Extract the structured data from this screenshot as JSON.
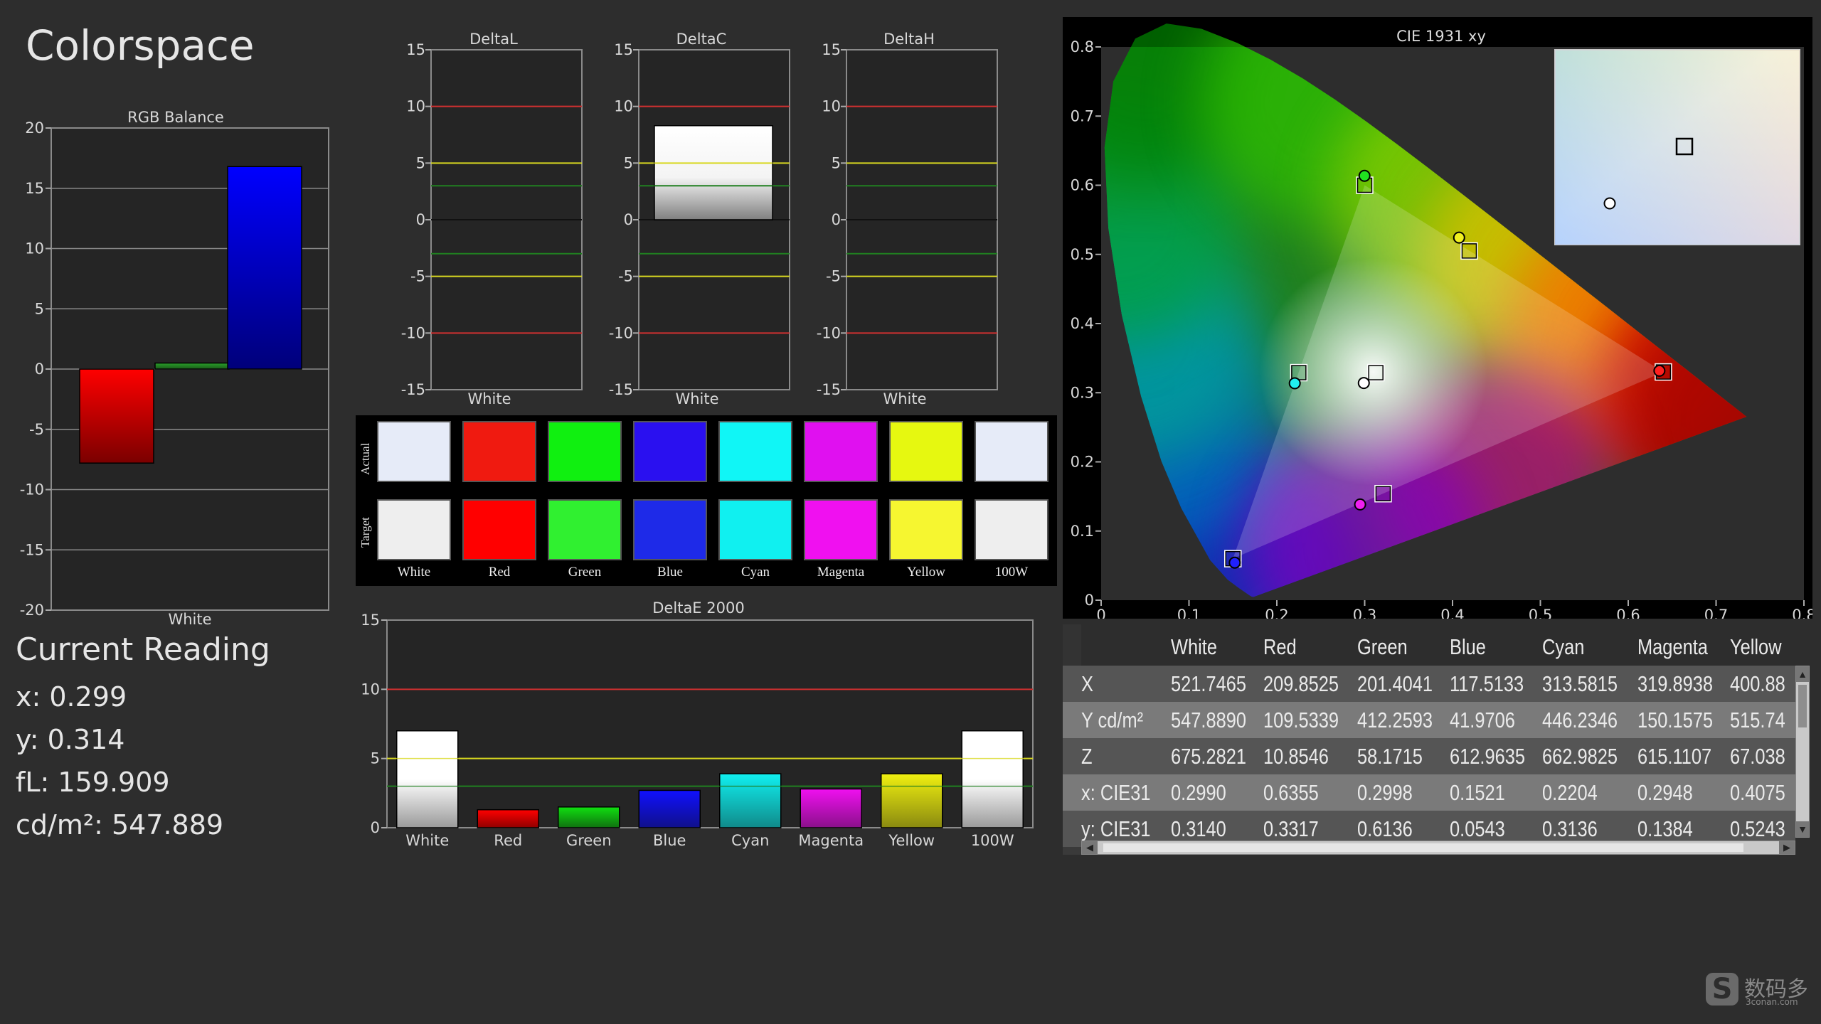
{
  "app_title": "Colorspace",
  "current_reading": {
    "title": "Current Reading",
    "x": "x: 0.299",
    "y": "y: 0.314",
    "fl": "fL: 159.909",
    "cdm2": "cd/m²: 547.889"
  },
  "rgb_balance": {
    "title": "RGB Balance",
    "category": "White",
    "ylim": [
      -20,
      20
    ],
    "yticks": [
      20,
      15,
      10,
      5,
      0,
      -5,
      -10,
      -15,
      -20
    ],
    "bars": [
      {
        "channel": "Red",
        "value": -7.8,
        "color": "#ff0000"
      },
      {
        "channel": "Green",
        "value": 0.5,
        "color": "#2a8a2a"
      },
      {
        "channel": "Blue",
        "value": 16.8,
        "color": "#0000ff"
      }
    ]
  },
  "delta_charts": [
    {
      "title": "DeltaL",
      "category": "White",
      "value": 0
    },
    {
      "title": "DeltaC",
      "category": "White",
      "value": 8.3
    },
    {
      "title": "DeltaH",
      "category": "White",
      "value": 0
    }
  ],
  "delta_ticks": [
    15,
    10,
    5,
    0,
    -5,
    -10,
    -15
  ],
  "delta_ticks_labels": [
    "15",
    "10",
    "5",
    "0",
    "-5",
    "-10",
    "-15"
  ],
  "swatches": {
    "actual_label": "Actual",
    "target_label": "Target",
    "items": [
      {
        "label": "White",
        "actual": "#e6ebf8",
        "target": "#eeeeee"
      },
      {
        "label": "Red",
        "actual": "#f01a10",
        "target": "#ff0000"
      },
      {
        "label": "Green",
        "actual": "#10f010",
        "target": "#30f030"
      },
      {
        "label": "Blue",
        "actual": "#2a10f0",
        "target": "#1e2ae8"
      },
      {
        "label": "Cyan",
        "actual": "#10f6f6",
        "target": "#10f0f0"
      },
      {
        "label": "Magenta",
        "actual": "#e010f0",
        "target": "#f010f0"
      },
      {
        "label": "Yellow",
        "actual": "#e6f810",
        "target": "#f6f630"
      },
      {
        "label": "100W",
        "actual": "#e6ebf8",
        "target": "#eeeeee"
      }
    ]
  },
  "chart_data": [
    {
      "type": "bar",
      "title": "RGB Balance",
      "categories": [
        "White"
      ],
      "series": [
        {
          "values": [
            -7.8
          ]
        },
        {
          "values": [
            0.5
          ]
        },
        {
          "values": [
            16.8
          ]
        }
      ],
      "ylim": [
        -20,
        20
      ]
    },
    {
      "type": "bar",
      "title": "DeltaE 2000",
      "categories": [
        "White",
        "Red",
        "Green",
        "Blue",
        "Cyan",
        "Magenta",
        "Yellow",
        "100W"
      ],
      "values": [
        7.0,
        1.3,
        1.5,
        2.7,
        3.9,
        2.8,
        3.9,
        7.0
      ],
      "colors": [
        "#ffffff",
        "#ff0000",
        "#10e010",
        "#1010ff",
        "#10f0f0",
        "#f010f0",
        "#f0f010",
        "#ffffff"
      ],
      "ylim": [
        0,
        15
      ],
      "thresholds": [
        {
          "value": 10,
          "color": "#d03030"
        },
        {
          "value": 5,
          "color": "#d8d820"
        },
        {
          "value": 3,
          "color": "#208020"
        }
      ]
    },
    {
      "type": "scatter",
      "title": "CIE 1931 xy",
      "xlim": [
        0,
        0.8
      ],
      "ylim": [
        0,
        0.8
      ],
      "xticks": [
        "0",
        "0.1",
        "0.2",
        "0.3",
        "0.4",
        "0.5",
        "0.6",
        "0.7",
        "0.8"
      ],
      "yticks": [
        "0",
        "0.1",
        "0.2",
        "0.3",
        "0.4",
        "0.5",
        "0.6",
        "0.7",
        "0.8"
      ],
      "targets": [
        {
          "name": "Red",
          "x": 0.64,
          "y": 0.33
        },
        {
          "name": "Green",
          "x": 0.3,
          "y": 0.6
        },
        {
          "name": "Blue",
          "x": 0.15,
          "y": 0.06
        },
        {
          "name": "Cyan",
          "x": 0.225,
          "y": 0.329
        },
        {
          "name": "Magenta",
          "x": 0.321,
          "y": 0.154
        },
        {
          "name": "Yellow",
          "x": 0.419,
          "y": 0.505
        },
        {
          "name": "White",
          "x": 0.3127,
          "y": 0.329
        }
      ],
      "measured": [
        {
          "name": "Red",
          "x": 0.6355,
          "y": 0.3317,
          "color": "#ff2020"
        },
        {
          "name": "Green",
          "x": 0.2998,
          "y": 0.6136,
          "color": "#20e020"
        },
        {
          "name": "Blue",
          "x": 0.1521,
          "y": 0.0543,
          "color": "#2020ff"
        },
        {
          "name": "Cyan",
          "x": 0.2204,
          "y": 0.3136,
          "color": "#20f0f0"
        },
        {
          "name": "Magenta",
          "x": 0.2948,
          "y": 0.1384,
          "color": "#f020f0"
        },
        {
          "name": "Yellow",
          "x": 0.4075,
          "y": 0.5243,
          "color": "#f0f020"
        },
        {
          "name": "White",
          "x": 0.299,
          "y": 0.314,
          "color": "#ffffff"
        }
      ]
    }
  ],
  "deltae_title": "DeltaE 2000",
  "deltae_ticks": [
    "15",
    "10",
    "5",
    "0"
  ],
  "cie_title": "CIE 1931 xy",
  "table": {
    "columns": [
      "White",
      "Red",
      "Green",
      "Blue",
      "Cyan",
      "Magenta",
      "Yellow"
    ],
    "rows": [
      {
        "label": "X",
        "values": [
          "521.7465",
          "209.8525",
          "201.4041",
          "117.5133",
          "313.5815",
          "319.8938",
          "400.88"
        ]
      },
      {
        "label": "Y cd/m²",
        "values": [
          "547.8890",
          "109.5339",
          "412.2593",
          "41.9706",
          "446.2346",
          "150.1575",
          "515.74"
        ]
      },
      {
        "label": "Z",
        "values": [
          "675.2821",
          "10.8546",
          "58.1715",
          "612.9635",
          "662.9825",
          "615.1107",
          "67.038"
        ]
      },
      {
        "label": "x: CIE31",
        "values": [
          "0.2990",
          "0.6355",
          "0.2998",
          "0.1521",
          "0.2204",
          "0.2948",
          "0.4075"
        ]
      },
      {
        "label": "y: CIE31",
        "values": [
          "0.3140",
          "0.3317",
          "0.6136",
          "0.0543",
          "0.3136",
          "0.1384",
          "0.5243"
        ]
      }
    ]
  },
  "watermark": {
    "text": "数码多",
    "sub": "3conan.com",
    "logo": "S"
  }
}
